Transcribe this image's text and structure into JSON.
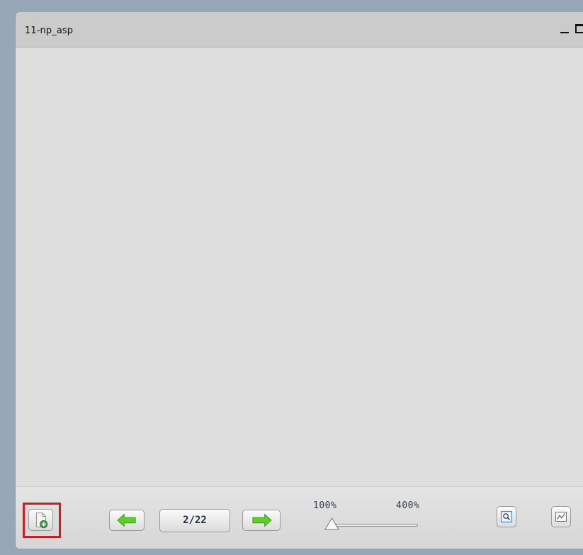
{
  "window": {
    "title": "11-np_asp"
  },
  "toolbar": {
    "page_indicator": "2/22",
    "zoom_min_label": "100%",
    "zoom_max_label": "400%",
    "zoom_level": 0,
    "icons": {
      "add": "add-page-icon",
      "prev": "arrow-left-icon",
      "next": "arrow-right-icon",
      "fit": "zoom-fit-icon",
      "chart": "line-chart-icon"
    }
  },
  "colors": {
    "highlight": "#c81f25",
    "arrow_green": "#5fcf2a",
    "background": "#97a7b7"
  }
}
